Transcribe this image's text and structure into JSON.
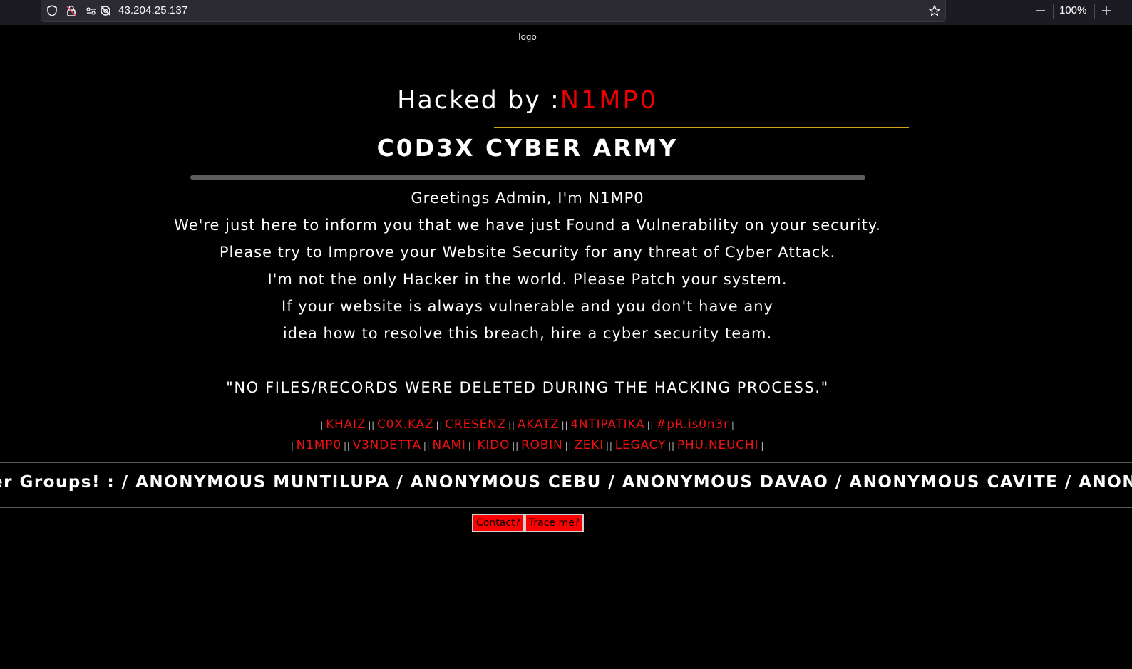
{
  "browser": {
    "url": "43.204.25.137",
    "zoom": "100%",
    "icons": [
      "shield-icon",
      "lock-insecure-icon",
      "permissions-icon",
      "tracking-off-icon",
      "bookmark-star-icon",
      "zoom-out-icon",
      "zoom-in-icon"
    ]
  },
  "page": {
    "logo_alt": "logo",
    "title_prefix": "Hacked by :",
    "title_name": "N1MP0",
    "group_name": "C0D3X CYBER ARMY",
    "message_lines": [
      "Greetings Admin, I'm N1MP0",
      "We're just here to inform you that we have just Found a Vulnerability on your security.",
      "Please try to Improve your Website Security for any threat of Cyber Attack.",
      "I'm not the only Hacker in the world. Please Patch your system.",
      "If your website is always vulnerable and you don't have any",
      "idea how to resolve this breach, hire a cyber security team."
    ],
    "disclaimer": "\"NO FILES/RECORDS WERE DELETED DURING THE HACKING PROCESS.\"",
    "members_row1": [
      "KHAIZ",
      "C0X.KAZ",
      "CRESENZ",
      "AKATZ",
      "4NTIPATIKA",
      "#pR.is0n3r"
    ],
    "members_row2": [
      "N1MP0",
      "V3NDETTA",
      "NAMI",
      "KIDO",
      "ROBIN",
      "ZEKI",
      "LEGACY",
      "PHU.NEUCHI"
    ],
    "marquee": "er Groups! : / ANONYMOUS MUNTILUPA / ANONYMOUS CEBU / ANONYMOUS DAVAO / ANONYMOUS CAVITE / ANONYMOUS",
    "buttons": {
      "contact": "Contact?",
      "trace": "Trace me?"
    }
  },
  "colors": {
    "accent_red": "#ee0000",
    "gold_line": "#d4a017",
    "background": "#000000",
    "button_red": "#ff0000"
  }
}
